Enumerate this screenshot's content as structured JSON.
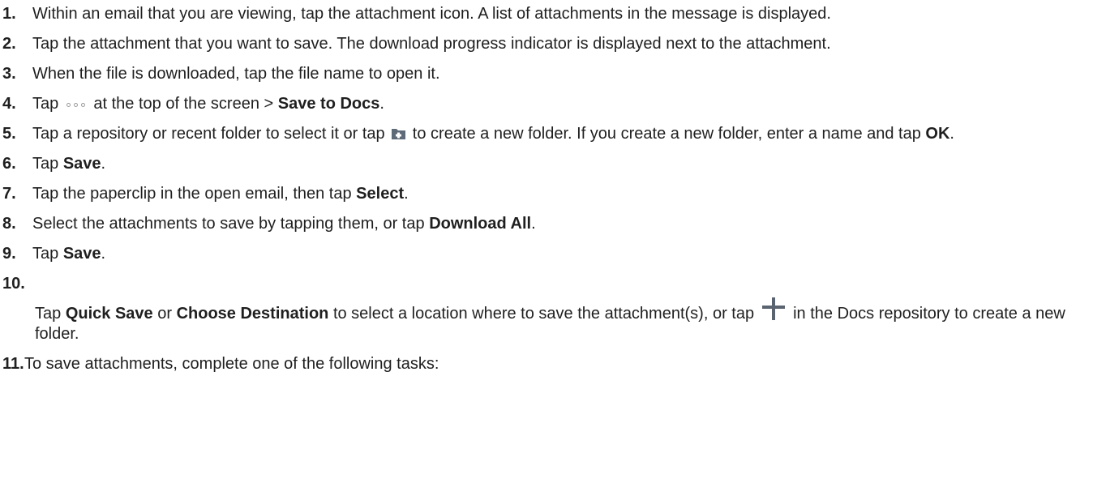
{
  "steps": [
    {
      "num": "1.",
      "text": "Within an email that you are viewing, tap the attachment icon. A list of attachments in the message is displayed."
    },
    {
      "num": "2.",
      "text": "Tap the attachment that you want to save. The download progress indicator is displayed next to the attachment."
    },
    {
      "num": "3.",
      "text": "When the file is downloaded, tap the file name to open it."
    },
    {
      "num": "4.",
      "pre": "Tap",
      "post": "at the top of the screen >",
      "bold": "Save to Docs",
      "end": "."
    },
    {
      "num": "5.",
      "pre": "Tap a repository or recent folder to select it or tap",
      "post": "to create a new folder. If you create a new folder, enter a name and tap",
      "bold": "OK",
      "end": "."
    },
    {
      "num": "6.",
      "pre": "Tap",
      "bold": "Save",
      "end": "."
    },
    {
      "num": "7.",
      "pre": "Tap the paperclip in the open email, then tap",
      "bold": "Select",
      "end": "."
    },
    {
      "num": "8.",
      "pre": "Select the attachments to save by tapping them, or tap",
      "bold": "Download All",
      "end": "."
    },
    {
      "num": "9.",
      "pre": "Tap",
      "bold": "Save",
      "end": "."
    },
    {
      "num": "10.",
      "pre": "Tap",
      "bold1": "Quick Save",
      "mid": "or",
      "bold2": "Choose Destination",
      "post": "to select a location where to save the attachment(s), or tap",
      "tail": "in the Docs repository to create a new folder."
    },
    {
      "num": "11.",
      "text": "To save attachments, complete one of the following tasks:"
    }
  ],
  "icons": {
    "more": "more-dots-icon",
    "new_folder": "new-folder-icon",
    "plus": "plus-icon"
  }
}
